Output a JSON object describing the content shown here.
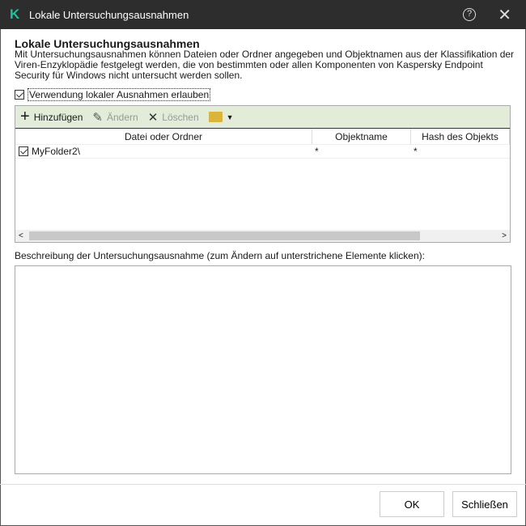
{
  "window": {
    "title": "Lokale Untersuchungsausnahmen",
    "logo": "K"
  },
  "heading": "Lokale Untersuchungsausnahmen",
  "description": "Mit Untersuchungsausnahmen können Dateien oder Ordner angegeben und Objektnamen aus der Klassifikation der Viren-Enzyklopädie festgelegt werden, die von bestimmten oder allen Komponenten von Kaspersky Endpoint Security für Windows nicht untersucht werden sollen.",
  "allow_checkbox": {
    "label": "Verwendung lokaler Ausnahmen erlauben",
    "checked": true
  },
  "toolbar": {
    "add": "Hinzufügen",
    "edit": "Ändern",
    "delete": "Löschen"
  },
  "table": {
    "columns": [
      "Datei oder Ordner",
      "Objektname",
      "Hash des Objekts"
    ],
    "rows": [
      {
        "path": "MyFolder2\\",
        "object": "*",
        "hash": "*",
        "checked": true
      }
    ]
  },
  "description_label": "Beschreibung der Untersuchungsausnahme (zum Ändern auf unterstrichene Elemente klicken):",
  "buttons": {
    "ok": "OK",
    "close": "Schließen"
  }
}
